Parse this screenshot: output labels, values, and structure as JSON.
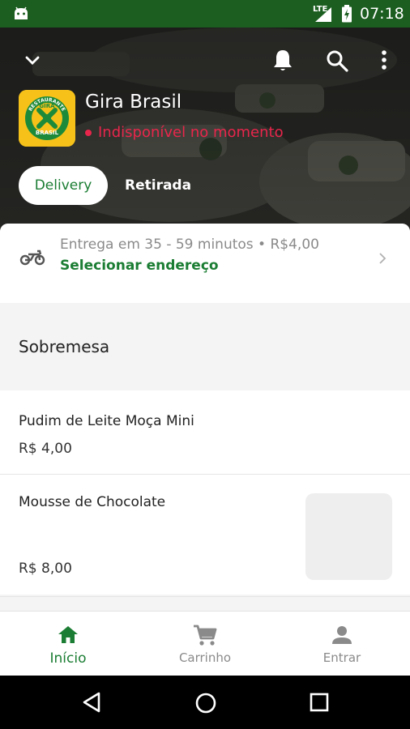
{
  "status_bar": {
    "network": "LTE",
    "time": "07:18"
  },
  "store": {
    "logo_text_top": "RESTAURANTE",
    "logo_text_mid": "GIRA",
    "logo_text_bottom": "BRASIL",
    "name": "Gira Brasil",
    "status": "Indisponível no momento"
  },
  "tabs": {
    "delivery": "Delivery",
    "pickup": "Retirada"
  },
  "delivery": {
    "info": "Entrega em 35 - 59 minutos • R$4,00",
    "address_action": "Selecionar endereço"
  },
  "section": {
    "title": "Sobremesa"
  },
  "items": [
    {
      "name": "Pudim de Leite Moça Mini",
      "price": "R$ 4,00"
    },
    {
      "name": "Mousse de Chocolate",
      "price": "R$ 8,00"
    }
  ],
  "bottom_nav": [
    {
      "label": "Início",
      "icon": "home-icon",
      "active": true
    },
    {
      "label": "Carrinho",
      "icon": "cart-icon",
      "active": false
    },
    {
      "label": "Entrar",
      "icon": "person-icon",
      "active": false
    }
  ],
  "colors": {
    "brand_green": "#1b7d33",
    "status_red": "#e8264b",
    "status_bar": "#1b5e20"
  }
}
